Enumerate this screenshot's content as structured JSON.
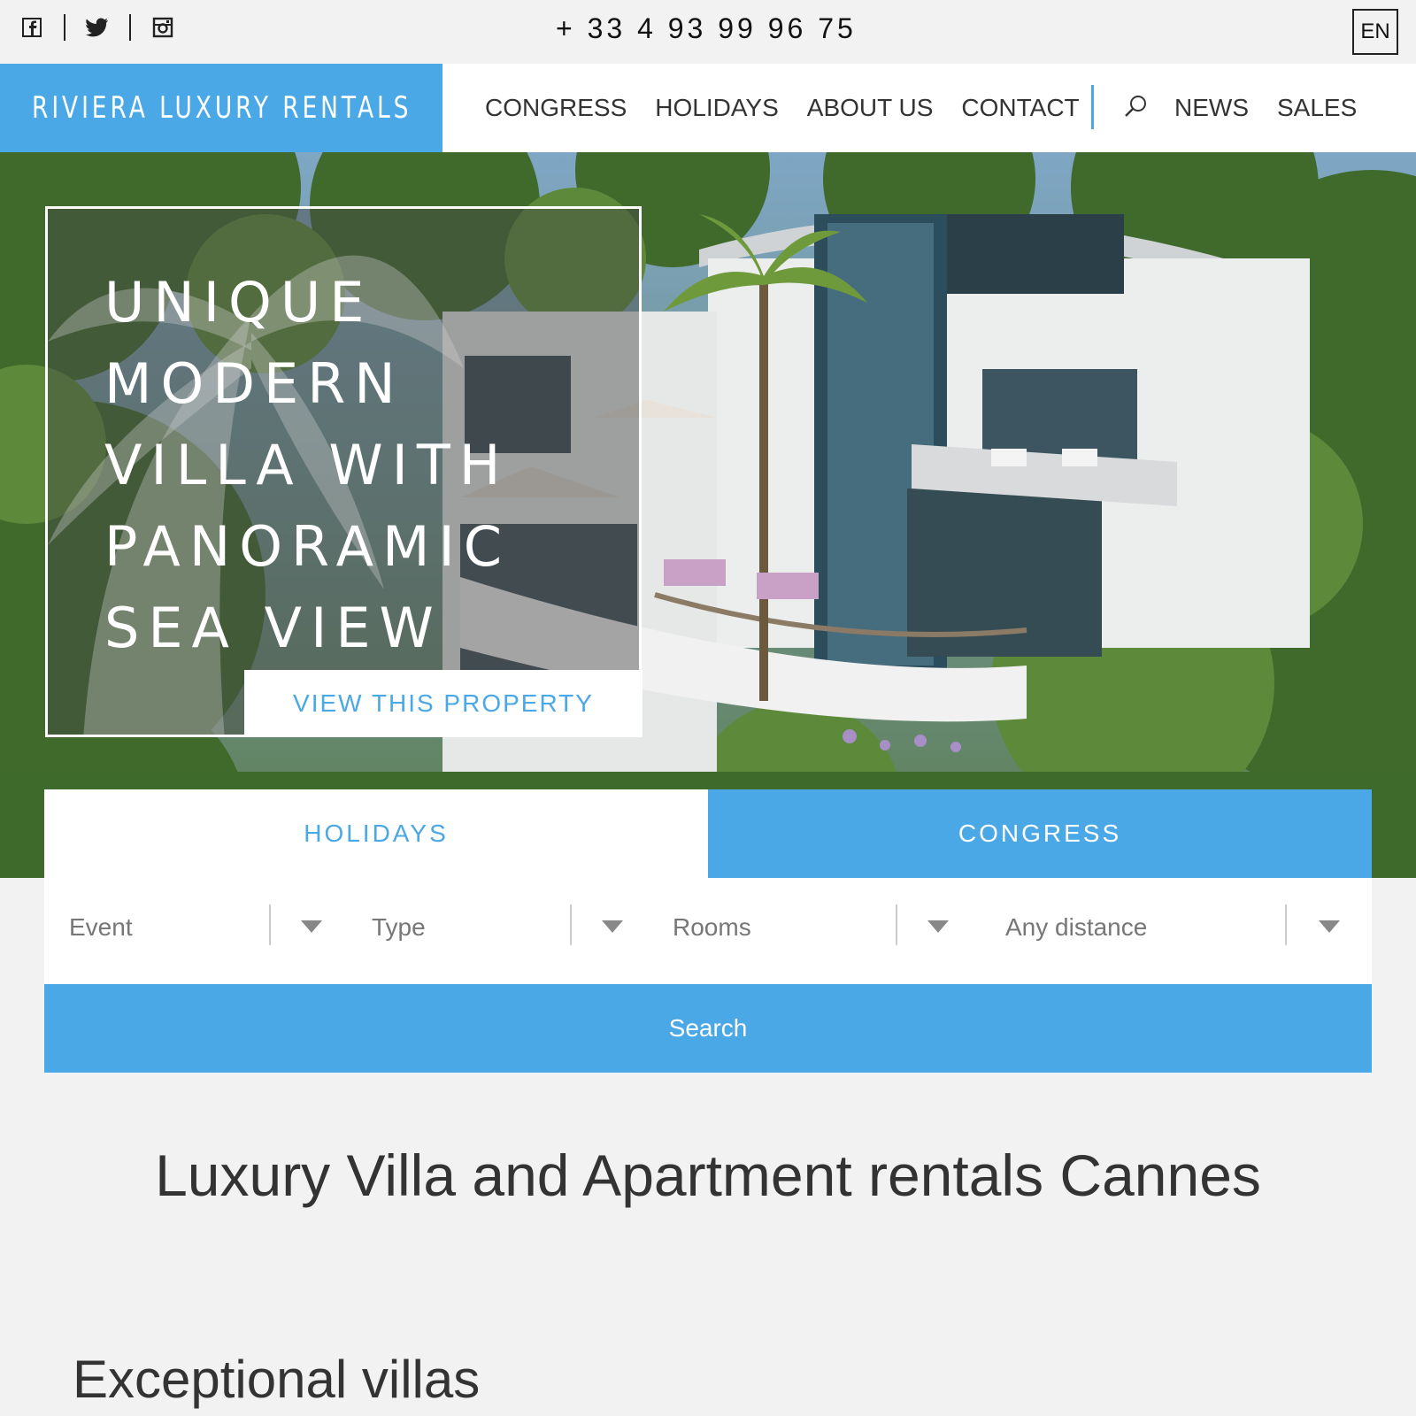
{
  "topbar": {
    "social": [
      "facebook-icon",
      "twitter-icon",
      "instagram-icon"
    ],
    "phone": "+ 33 4 93 99 96 75",
    "language": "EN"
  },
  "header": {
    "logo_text": "RIVIERA LUXURY RENTALS",
    "nav_left": [
      "CONGRESS",
      "HOLIDAYS",
      "ABOUT US",
      "CONTACT"
    ],
    "nav_right": [
      "NEWS",
      "SALES"
    ]
  },
  "hero": {
    "title_lines": [
      "UNIQUE",
      "MODERN",
      "VILLA WITH",
      "PANORAMIC",
      "SEA VIEW"
    ],
    "cta": "VIEW THIS PROPERTY"
  },
  "search": {
    "tabs": [
      {
        "label": "HOLIDAYS",
        "active": false
      },
      {
        "label": "CONGRESS",
        "active": true
      }
    ],
    "filters": [
      "Event",
      "Type",
      "Rooms",
      "Any distance"
    ],
    "button": "Search"
  },
  "main": {
    "heading": "Luxury Villa and Apartment rentals Cannes",
    "section_heading": "Exceptional villas"
  },
  "colors": {
    "accent": "#4aa8e6",
    "background": "#f2f2f2",
    "text": "#333333"
  }
}
